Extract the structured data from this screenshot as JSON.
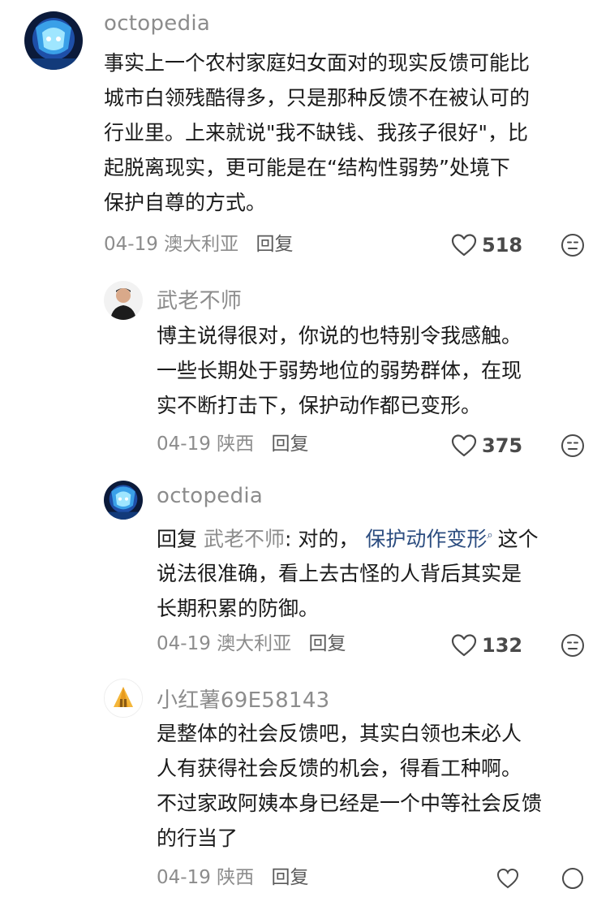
{
  "comments": [
    {
      "username": "octopedia",
      "lines": [
        "事实上一个农村家庭妇女面对的现实反馈可能比",
        "城市白领残酷得多，只是那种反馈不在被认可的",
        "行业里。上来就说\"我不缺钱、我孩子很好\"，比",
        "起脱离现实，更可能是在“结构性弱势”处境下",
        "保护自尊的方式。"
      ],
      "date": "04-19",
      "location": "澳大利亚",
      "reply_label": "回复",
      "likes": "518"
    },
    {
      "username": "武老不师",
      "lines": [
        "博主说得很对，你说的也特别令我感触。",
        "一些长期处于弱势地位的弱势群体，在现",
        "实不断打击下，保护动作都已变形。"
      ],
      "date": "04-19",
      "location": "陕西",
      "reply_label": "回复",
      "likes": "375"
    },
    {
      "username": "octopedia",
      "reply_prefix": "回复",
      "reply_target": "武老不师",
      "reply_colon": ": 对的，",
      "link_text": "保护动作变形",
      "search_icon": "search-icon",
      "line1_tail": "这个",
      "lines": [
        "说法很准确，看上去古怪的人背后其实是",
        "长期积累的防御。"
      ],
      "date": "04-19",
      "location": "澳大利亚",
      "reply_label": "回复",
      "likes": "132"
    },
    {
      "username": "小红薯69E58143",
      "lines": [
        "是整体的社会反馈吧，其实白领也未必人",
        "人有获得社会反馈的机会，得看工种啊。",
        "不过家政阿姨本身已经是一个中等社会反馈",
        "的行当了"
      ],
      "date": "04-19",
      "location": "陕西",
      "reply_label": "回复"
    }
  ],
  "colors": {
    "meta": "#8c8c8c",
    "link": "#2c4d80",
    "text": "#1a1a1a"
  }
}
